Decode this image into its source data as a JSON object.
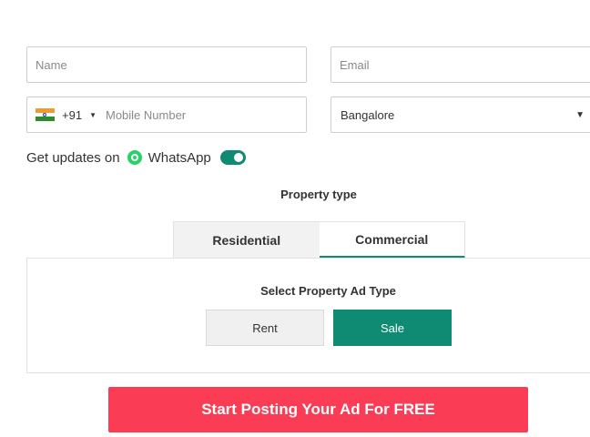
{
  "form": {
    "name_placeholder": "Name",
    "email_placeholder": "Email",
    "country_code": "+91",
    "country_flag": "india-flag-icon",
    "mobile_placeholder": "Mobile Number",
    "city_value": "Bangalore",
    "updates_prefix": "Get updates on",
    "updates_channel": "WhatsApp",
    "whatsapp_toggle_on": true
  },
  "property_type": {
    "label": "Property type",
    "tabs": [
      {
        "label": "Residential",
        "active": false
      },
      {
        "label": "Commercial",
        "active": true
      }
    ]
  },
  "ad_type": {
    "label": "Select Property Ad Type",
    "options": [
      {
        "label": "Rent",
        "selected": false
      },
      {
        "label": "Sale",
        "selected": true
      }
    ]
  },
  "cta": {
    "label": "Start Posting Your Ad For FREE"
  },
  "colors": {
    "accent_green": "#0e8b72",
    "cta_red": "#fa3c55",
    "whatsapp_green": "#25d366"
  }
}
